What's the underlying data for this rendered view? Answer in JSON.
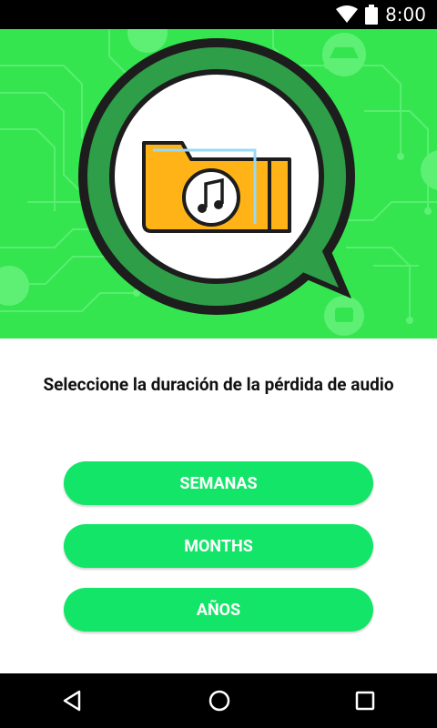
{
  "status": {
    "time": "8:00"
  },
  "prompt": {
    "text": "Seleccione la duración de la pérdida de audio"
  },
  "buttons": [
    {
      "label": "SEMANAS"
    },
    {
      "label": "MONTHS"
    },
    {
      "label": "AÑOS"
    }
  ],
  "colors": {
    "hero_bg": "#34e54f",
    "button_bg": "#12e567",
    "folder": "#ffb316",
    "bubble": "#2e9e48"
  },
  "icons": {
    "wifi": "wifi-icon",
    "battery": "battery-icon",
    "back": "back-triangle-icon",
    "home": "home-circle-icon",
    "recents": "recents-square-icon"
  }
}
